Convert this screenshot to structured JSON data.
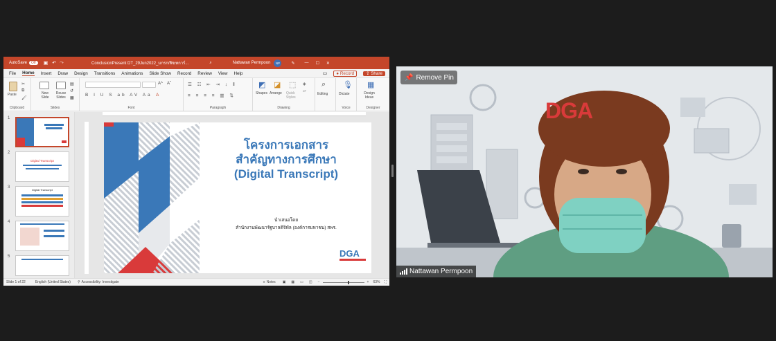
{
  "ppt": {
    "autosave": "AutoSave",
    "autosave_state": "Off",
    "filename": "ConclusionPresent DT_29Jun2022_มกรก/ฟิฆทการ์...",
    "user_name": "Nattawan Permpoon",
    "user_initials": "NP",
    "menu_tabs": [
      "File",
      "Home",
      "Insert",
      "Draw",
      "Design",
      "Transitions",
      "Animations",
      "Slide Show",
      "Record",
      "Review",
      "View",
      "Help"
    ],
    "active_tab": "Home",
    "record_label": "Record",
    "share_label": "Share",
    "ribbon": {
      "paste": "Paste",
      "new_slide": "New Slide",
      "reuse_slides": "Reuse Slides",
      "shapes": "Shapes",
      "arrange": "Arrange",
      "quick_styles": "Quick Styles",
      "editing": "Editing",
      "dictate": "Dictate",
      "design_ideas": "Design Ideas",
      "groups": [
        "Clipboard",
        "Slides",
        "Font",
        "Paragraph",
        "Drawing",
        "Voice",
        "Designer"
      ]
    },
    "thumbnails": [
      {
        "num": "1",
        "title": "โครงการเอกสารสำคัญทางการศึกษา (Digital Transcript)"
      },
      {
        "num": "2",
        "title": "Digital Transcript"
      },
      {
        "num": "3",
        "title": "Digital Transcript"
      },
      {
        "num": "4",
        "title": ""
      },
      {
        "num": "5",
        "title": ""
      }
    ],
    "slide": {
      "title_line1": "โครงการเอกสาร",
      "title_line2": "สำคัญทางการศึกษา",
      "title_line3": "(Digital Transcript)",
      "presenter_label": "นำเสนอโดย",
      "presenter_org": "สำนักงานพัฒนารัฐบาลดิจิทัล (องค์การมหาชน) สพร.",
      "logo": "DGA"
    },
    "status": {
      "slide_count": "Slide 1 of 22",
      "language": "English (United States)",
      "accessibility": "Accessibility: Investigate",
      "notes": "Notes",
      "zoom": "63%"
    },
    "colors": {
      "accent": "#c4462a",
      "slide_blue": "#3a78b8",
      "slide_red": "#d93a3a"
    }
  },
  "video": {
    "remove_pin": "Remove Pin",
    "participant_name": "Nattawan Permpoon",
    "signal_icon": "signal-bars-icon",
    "backdrop_logo": "DGA"
  }
}
